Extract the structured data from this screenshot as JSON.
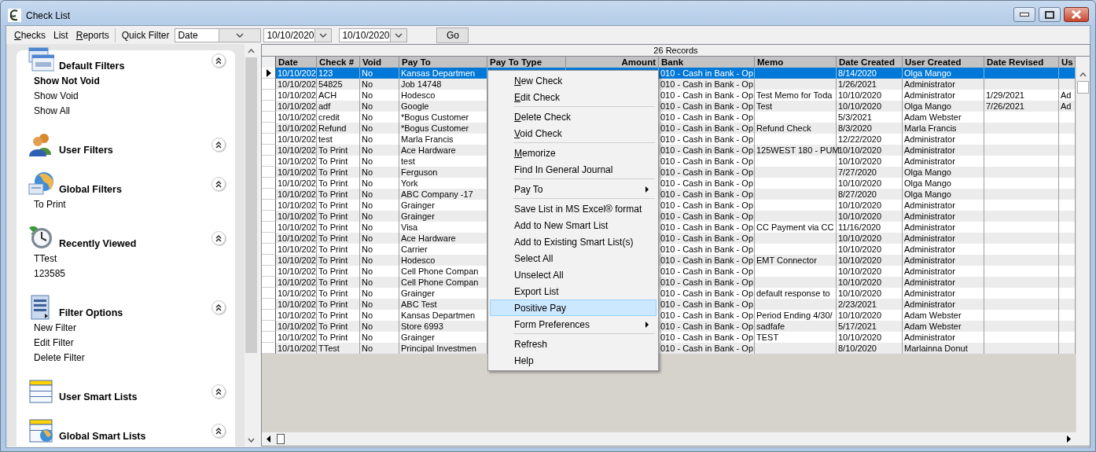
{
  "window": {
    "title": "Check List"
  },
  "menu_bar": [
    {
      "label": "Checks",
      "mnemonic": true
    },
    {
      "label": "List",
      "mnemonic": false
    },
    {
      "label": "Reports",
      "mnemonic": true
    }
  ],
  "quick_filter": {
    "label": "Quick Filter",
    "field": "Date",
    "from": "10/10/2020",
    "to": "10/10/2020",
    "button": "Go"
  },
  "sidebar": {
    "sections": [
      {
        "title": "Default Filters",
        "kind": "auto",
        "expanded": true,
        "items": [
          {
            "label": "Show Not Void",
            "selected": true
          },
          {
            "label": "Show Void",
            "selected": false
          },
          {
            "label": "Show All",
            "selected": false
          }
        ]
      },
      {
        "title": "User Filters",
        "kind": "users",
        "expanded": true
      },
      {
        "title": "Global Filters",
        "kind": "globe",
        "expanded": true,
        "items": [
          {
            "label": "To Print",
            "selected": false
          }
        ]
      },
      {
        "title": "Recently Viewed",
        "kind": "clock",
        "expanded": true,
        "items": [
          {
            "label": "TTest",
            "selected": false
          },
          {
            "label": "123585",
            "selected": false
          }
        ]
      },
      {
        "title": "Filter Options",
        "kind": "list",
        "expanded": true,
        "items": [
          {
            "label": "New Filter",
            "selected": false
          },
          {
            "label": "Edit Filter",
            "selected": false
          },
          {
            "label": "Delete Filter",
            "selected": false
          }
        ]
      },
      {
        "title": "User Smart Lists",
        "kind": "table",
        "expanded": true
      },
      {
        "title": "Global Smart Lists",
        "kind": "table-globe",
        "expanded": true
      }
    ]
  },
  "table": {
    "record_count": "26 Records",
    "columns": [
      "Date",
      "Check #",
      "Void",
      "Pay To",
      "Pay To Type",
      "Amount",
      "Bank",
      "Memo",
      "Date Created",
      "User Created",
      "Date Revised",
      "Us"
    ],
    "rows": [
      {
        "selected": true,
        "date": "10/10/202",
        "check_no": "123",
        "void": "No",
        "pay_to": "Kansas Departmen",
        "bank": "010 - Cash in Bank - Op",
        "date_created": "8/14/2020",
        "user_created": "Olga Mango"
      },
      {
        "selected": false,
        "date": "10/10/202",
        "check_no": "54825",
        "void": "No",
        "pay_to": "Job 14748",
        "bank": "010 - Cash in Bank - Op",
        "date_created": "1/26/2021",
        "user_created": "Administrator"
      },
      {
        "selected": false,
        "date": "10/10/202",
        "check_no": "ACH",
        "void": "No",
        "pay_to": "Hodesco",
        "bank": "010 - Cash in Bank - Op",
        "memo": "Test Memo for Toda",
        "date_created": "10/10/2020",
        "user_created": "Administrator",
        "date_revised": "1/29/2021",
        "column_12": "Ad"
      },
      {
        "selected": false,
        "date": "10/10/202",
        "check_no": "adf",
        "void": "No",
        "pay_to": "Google",
        "bank": "010 - Cash in Bank - Op",
        "memo": "Test",
        "date_created": "10/10/2020",
        "user_created": "Olga Mango",
        "date_revised": "7/26/2021",
        "column_12": "Ad"
      },
      {
        "selected": false,
        "date": "10/10/202",
        "check_no": "credit",
        "void": "No",
        "pay_to": "*Bogus Customer",
        "bank": "010 - Cash in Bank - Op",
        "date_created": "5/3/2021",
        "user_created": "Adam Webster"
      },
      {
        "selected": false,
        "date": "10/10/202",
        "check_no": "Refund",
        "void": "No",
        "pay_to": "*Bogus Customer",
        "bank": "010 - Cash in Bank - Op",
        "memo": "Refund Check",
        "date_created": "8/3/2020",
        "user_created": "Marla Francis"
      },
      {
        "selected": false,
        "date": "10/10/202",
        "check_no": "test",
        "void": "No",
        "pay_to": "Marla Francis",
        "bank": "010 - Cash in Bank - Op",
        "date_created": "12/22/2020",
        "user_created": "Administrator"
      },
      {
        "selected": false,
        "date": "10/10/202",
        "check_no": "To Print",
        "void": "No",
        "pay_to": "Ace Hardware",
        "bank": "010 - Cash in Bank - Op",
        "memo": "125WEST 180 - PUM",
        "date_created": "10/10/2020",
        "user_created": "Administrator"
      },
      {
        "selected": false,
        "date": "10/10/202",
        "check_no": "To Print",
        "void": "No",
        "pay_to": "test",
        "bank": "010 - Cash in Bank - Op",
        "date_created": "10/10/2020",
        "user_created": "Administrator"
      },
      {
        "selected": false,
        "date": "10/10/202",
        "check_no": "To Print",
        "void": "No",
        "pay_to": "Ferguson",
        "bank": "010 - Cash in Bank - Op",
        "date_created": "7/27/2020",
        "user_created": "Olga Mango"
      },
      {
        "selected": false,
        "date": "10/10/202",
        "check_no": "To Print",
        "void": "No",
        "pay_to": "York",
        "bank": "010 - Cash in Bank - Op",
        "date_created": "10/10/2020",
        "user_created": "Olga Mango"
      },
      {
        "selected": false,
        "date": "10/10/202",
        "check_no": "To Print",
        "void": "No",
        "pay_to": "ABC Company -17",
        "bank": "010 - Cash in Bank - Op",
        "date_created": "8/27/2020",
        "user_created": "Olga Mango"
      },
      {
        "selected": false,
        "date": "10/10/202",
        "check_no": "To Print",
        "void": "No",
        "pay_to": "Grainger",
        "bank": "010 - Cash in Bank - Op",
        "date_created": "10/10/2020",
        "user_created": "Administrator"
      },
      {
        "selected": false,
        "date": "10/10/202",
        "check_no": "To Print",
        "void": "No",
        "pay_to": "Grainger",
        "bank": "010 - Cash in Bank - Op",
        "date_created": "10/10/2020",
        "user_created": "Administrator"
      },
      {
        "selected": false,
        "date": "10/10/202",
        "check_no": "To Print",
        "void": "No",
        "pay_to": "Visa",
        "bank": "010 - Cash in Bank - Op",
        "memo": "CC Payment via CC",
        "date_created": "11/16/2020",
        "user_created": "Administrator"
      },
      {
        "selected": false,
        "date": "10/10/202",
        "check_no": "To Print",
        "void": "No",
        "pay_to": "Ace Hardware",
        "bank": "010 - Cash in Bank - Op",
        "date_created": "10/10/2020",
        "user_created": "Administrator"
      },
      {
        "selected": false,
        "date": "10/10/202",
        "check_no": "To Print",
        "void": "No",
        "pay_to": "Carrier",
        "bank": "010 - Cash in Bank - Op",
        "date_created": "10/10/2020",
        "user_created": "Administrator"
      },
      {
        "selected": false,
        "date": "10/10/202",
        "check_no": "To Print",
        "void": "No",
        "pay_to": "Hodesco",
        "bank": "010 - Cash in Bank - Op",
        "memo": "EMT Connector",
        "date_created": "10/10/2020",
        "user_created": "Administrator"
      },
      {
        "selected": false,
        "date": "10/10/202",
        "check_no": "To Print",
        "void": "No",
        "pay_to": "Cell Phone Compan",
        "bank": "010 - Cash in Bank - Op",
        "date_created": "10/10/2020",
        "user_created": "Administrator"
      },
      {
        "selected": false,
        "date": "10/10/202",
        "check_no": "To Print",
        "void": "No",
        "pay_to": "Cell Phone Compan",
        "bank": "010 - Cash in Bank - Op",
        "date_created": "10/10/2020",
        "user_created": "Administrator"
      },
      {
        "selected": false,
        "date": "10/10/202",
        "check_no": "To Print",
        "void": "No",
        "pay_to": "Grainger",
        "bank": "010 - Cash in Bank - Op",
        "memo": "default response to",
        "date_created": "10/10/2020",
        "user_created": "Administrator"
      },
      {
        "selected": false,
        "date": "10/10/202",
        "check_no": "To Print",
        "void": "No",
        "pay_to": "ABC Test",
        "bank": "010 - Cash in Bank - Op",
        "date_created": "2/23/2021",
        "user_created": "Administrator"
      },
      {
        "selected": false,
        "date": "10/10/202",
        "check_no": "To Print",
        "void": "No",
        "pay_to": "Kansas Departmen",
        "bank": "010 - Cash in Bank - Op",
        "memo": "Period Ending 4/30/",
        "date_created": "10/10/2020",
        "user_created": "Adam Webster"
      },
      {
        "selected": false,
        "date": "10/10/202",
        "check_no": "To Print",
        "void": "No",
        "pay_to": "Store 6993",
        "bank": "010 - Cash in Bank - Op",
        "memo": "sadfafe",
        "date_created": "5/17/2021",
        "user_created": "Adam Webster"
      },
      {
        "selected": false,
        "date": "10/10/202",
        "check_no": "To Print",
        "void": "No",
        "pay_to": "Grainger",
        "bank": "010 - Cash in Bank - Op",
        "memo": "TEST",
        "date_created": "10/10/2020",
        "user_created": "Administrator"
      },
      {
        "selected": false,
        "date": "10/10/202",
        "check_no": "TTest",
        "void": "No",
        "pay_to": "Principal Investmen",
        "bank": "010 - Cash in Bank - Op",
        "date_created": "8/10/2020",
        "user_created": "Marlainna Donut"
      }
    ]
  },
  "context_menu": {
    "items": [
      {
        "kind": "item",
        "label": "New Check",
        "mnemonic": true,
        "submenu": false,
        "selected": false
      },
      {
        "kind": "item",
        "label": "Edit Check",
        "mnemonic": true,
        "submenu": false,
        "selected": false
      },
      {
        "kind": "separator"
      },
      {
        "kind": "item",
        "label": "Delete Check",
        "mnemonic": true,
        "submenu": false,
        "selected": false
      },
      {
        "kind": "item",
        "label": "Void Check",
        "mnemonic": true,
        "submenu": false,
        "selected": false
      },
      {
        "kind": "separator"
      },
      {
        "kind": "item",
        "label": "Memorize",
        "mnemonic": true,
        "submenu": false,
        "selected": false
      },
      {
        "kind": "item",
        "label": "Find In General Journal",
        "mnemonic": false,
        "submenu": false,
        "selected": false
      },
      {
        "kind": "separator"
      },
      {
        "kind": "item",
        "label": "Pay To",
        "mnemonic": false,
        "submenu": true,
        "selected": false
      },
      {
        "kind": "separator"
      },
      {
        "kind": "item",
        "label": "Save List in MS Excel® format",
        "mnemonic": false,
        "submenu": false,
        "selected": false
      },
      {
        "kind": "item",
        "label": "Add to New Smart List",
        "mnemonic": false,
        "submenu": false,
        "selected": false
      },
      {
        "kind": "item",
        "label": "Add to Existing Smart List(s)",
        "mnemonic": false,
        "submenu": false,
        "selected": false
      },
      {
        "kind": "item",
        "label": "Select All",
        "mnemonic": false,
        "submenu": false,
        "selected": false
      },
      {
        "kind": "item",
        "label": "Unselect All",
        "mnemonic": false,
        "submenu": false,
        "selected": false
      },
      {
        "kind": "item",
        "label": "Export List",
        "mnemonic": false,
        "submenu": false,
        "selected": false
      },
      {
        "kind": "item",
        "label": "Positive Pay",
        "mnemonic": false,
        "submenu": false,
        "selected": true
      },
      {
        "kind": "item",
        "label": "Form Preferences",
        "mnemonic": false,
        "submenu": true,
        "selected": false
      },
      {
        "kind": "separator"
      },
      {
        "kind": "item",
        "label": "Refresh",
        "mnemonic": false,
        "submenu": false,
        "selected": false
      },
      {
        "kind": "item",
        "label": "Help",
        "mnemonic": false,
        "submenu": false,
        "selected": false
      }
    ]
  }
}
